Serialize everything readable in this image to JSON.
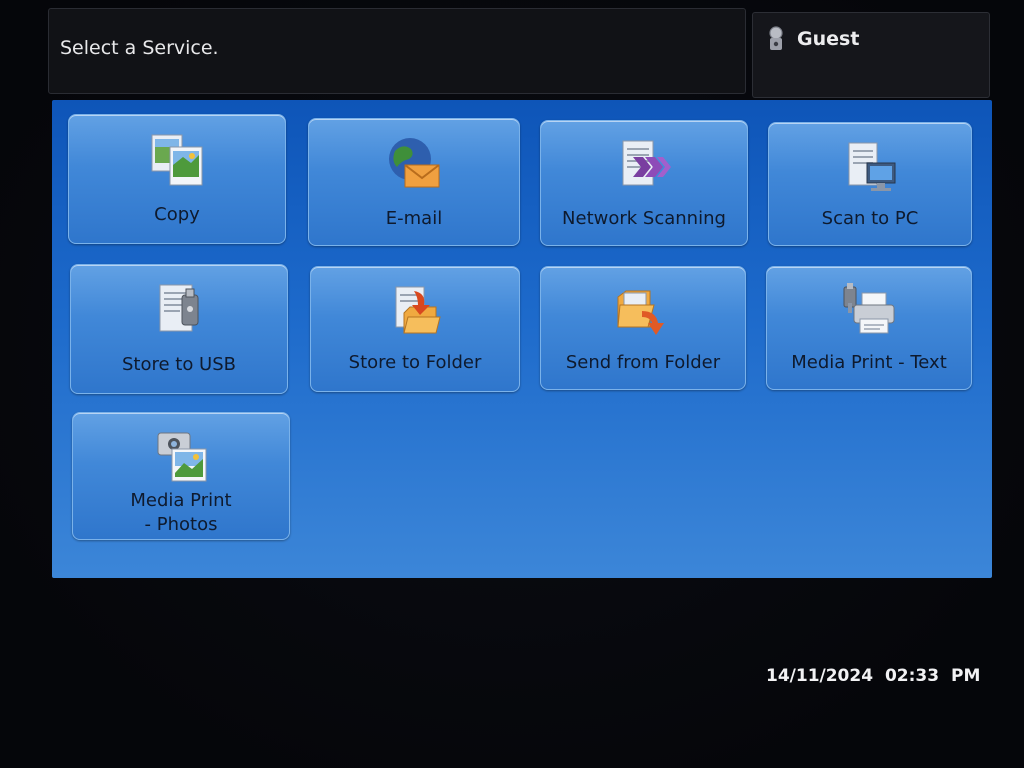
{
  "header": {
    "message": "Select a Service.",
    "user_label": "Guest",
    "user_icon": "user-key-icon"
  },
  "services": [
    {
      "label": "Copy",
      "icon": "copy-icon"
    },
    {
      "label": "E-mail",
      "icon": "email-icon"
    },
    {
      "label": "Network Scanning",
      "icon": "network-scanning-icon"
    },
    {
      "label": "Scan to PC",
      "icon": "scan-to-pc-icon"
    },
    {
      "label": "Store to USB",
      "icon": "store-to-usb-icon"
    },
    {
      "label": "Store to Folder",
      "icon": "store-to-folder-icon"
    },
    {
      "label": "Send from Folder",
      "icon": "send-from-folder-icon"
    },
    {
      "label": "Media Print - Text",
      "icon": "media-print-text-icon"
    },
    {
      "label_line1": "Media Print",
      "label_line2": "- Photos",
      "icon": "media-print-photos-icon"
    }
  ],
  "footer": {
    "date": "14/11/2024",
    "time": "02:33 PM"
  },
  "colors": {
    "panel_blue": "#1d6acb",
    "tile_blue": "#4188d8",
    "header_bg": "#111216"
  }
}
